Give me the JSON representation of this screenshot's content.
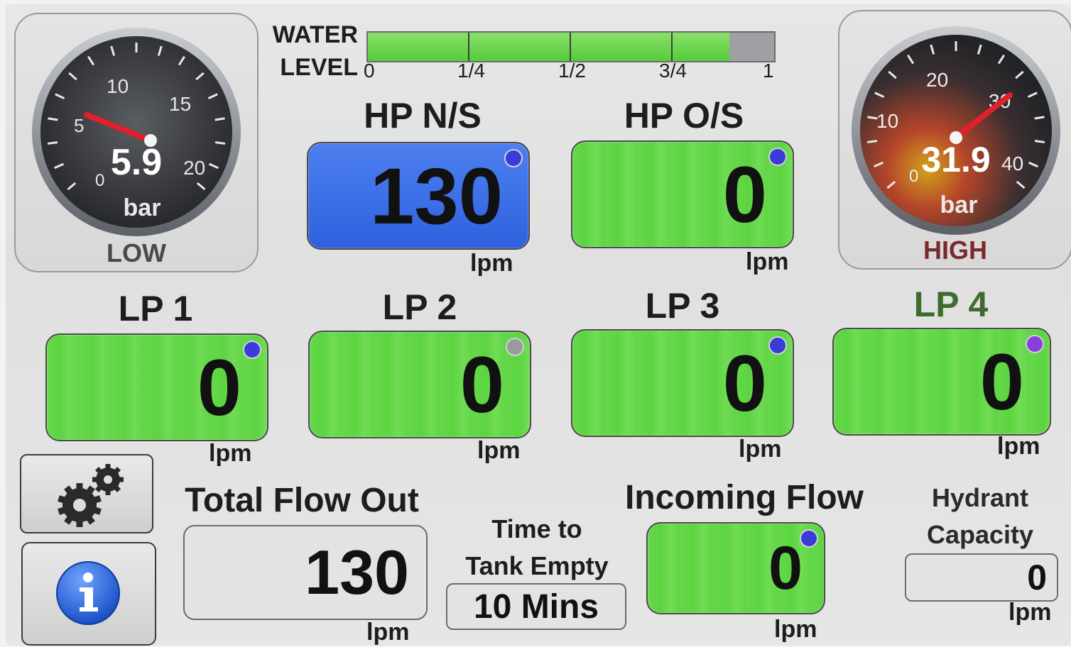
{
  "water_level": {
    "label_line1": "WATER",
    "label_line2": "LEVEL",
    "fill_fraction": 0.89,
    "ticks": [
      "0",
      "1/4",
      "1/2",
      "3/4",
      "1"
    ]
  },
  "low_gauge": {
    "caption": "LOW",
    "value": "5.9",
    "unit": "bar",
    "scale": [
      "0",
      "5",
      "10",
      "15",
      "20"
    ],
    "needle_value": 5.9
  },
  "high_gauge": {
    "caption": "HIGH",
    "value": "31.9",
    "unit": "bar",
    "scale": [
      "0",
      "10",
      "20",
      "30",
      "40"
    ],
    "needle_value": 31.9
  },
  "outlets": [
    {
      "id": "hp-ns",
      "label": "HP N/S",
      "value": "130",
      "unit": "lpm",
      "state": "active"
    },
    {
      "id": "hp-os",
      "label": "HP O/S",
      "value": "0",
      "unit": "lpm",
      "state": "idle"
    },
    {
      "id": "lp1",
      "label": "LP 1",
      "value": "0",
      "unit": "lpm",
      "state": "idle"
    },
    {
      "id": "lp2",
      "label": "LP 2",
      "value": "0",
      "unit": "lpm",
      "state": "idle"
    },
    {
      "id": "lp3",
      "label": "LP 3",
      "value": "0",
      "unit": "lpm",
      "state": "idle"
    },
    {
      "id": "lp4",
      "label": "LP 4",
      "value": "0",
      "unit": "lpm",
      "state": "idle"
    }
  ],
  "total_flow": {
    "label": "Total Flow Out",
    "value": "130",
    "unit": "lpm"
  },
  "tank_time": {
    "label_line1": "Time to",
    "label_line2": "Tank Empty",
    "value": "10 Mins"
  },
  "incoming_flow": {
    "label": "Incoming Flow",
    "value": "0",
    "unit": "lpm"
  },
  "hydrant": {
    "label_line1": "Hydrant",
    "label_line2": "Capacity",
    "value": "0",
    "unit": "lpm"
  },
  "colors": {
    "active_box": "#3a6ee6",
    "idle_box": "#62d646",
    "indicator_blue": "#3b3bd8",
    "indicator_grey": "#9a9a9a",
    "indicator_violet": "#8a3ee0",
    "needle": "#e0202a",
    "lp4_label": "#3f6b2f"
  },
  "icons": {
    "settings": "gears-icon",
    "info": "info-icon"
  }
}
